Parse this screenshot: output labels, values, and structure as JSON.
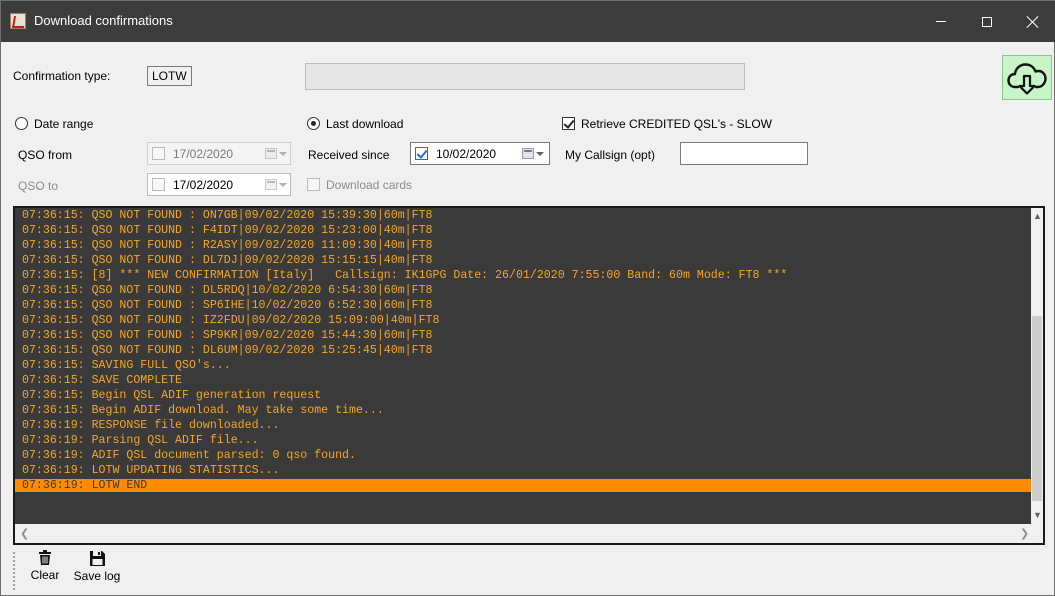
{
  "window": {
    "title": "Download confirmations",
    "title_bar_color": "#3c3c3c"
  },
  "form": {
    "confirmation_type_label": "Confirmation type:",
    "confirmation_type_value": "LOTW",
    "status_text": "",
    "date_range_label": "Date range",
    "date_range_selected": false,
    "last_download_label": "Last download",
    "last_download_selected": true,
    "retrieve_credited_label": "Retrieve CREDITED QSL's - SLOW",
    "retrieve_credited_checked": true,
    "qso_from_label": "QSO from",
    "qso_from_date": "17/02/2020",
    "qso_to_label": "QSO to",
    "qso_to_date": "17/02/2020",
    "received_since_label": "Received since",
    "received_since_date": "10/02/2020",
    "received_since_checked": true,
    "download_cards_label": "Download cards",
    "download_cards_checked": false,
    "my_callsign_label": "My Callsign (opt)",
    "my_callsign_value": ""
  },
  "download_button": {
    "icon": "cloud-download-icon",
    "background": "#c8f5c8"
  },
  "log": {
    "background": "#3a3a3a",
    "text_color": "#f5a623",
    "highlight_color": "#ff8c00",
    "lines": [
      "07:36:15: QSO NOT FOUND : ON7GB|09/02/2020 15:39:30|60m|FT8",
      "07:36:15: QSO NOT FOUND : F4IDT|09/02/2020 15:23:00|40m|FT8",
      "07:36:15: QSO NOT FOUND : R2ASY|09/02/2020 11:09:30|40m|FT8",
      "07:36:15: QSO NOT FOUND : DL7DJ|09/02/2020 15:15:15|40m|FT8",
      "07:36:15: [8] *** NEW CONFIRMATION [Italy]   Callsign: IK1GPG Date: 26/01/2020 7:55:00 Band: 60m Mode: FT8 ***",
      "07:36:15: QSO NOT FOUND : DL5RDQ|10/02/2020 6:54:30|60m|FT8",
      "07:36:15: QSO NOT FOUND : SP6IHE|10/02/2020 6:52:30|60m|FT8",
      "07:36:15: QSO NOT FOUND : IZ2FDU|09/02/2020 15:09:00|40m|FT8",
      "07:36:15: QSO NOT FOUND : SP9KR|09/02/2020 15:44:30|60m|FT8",
      "07:36:15: QSO NOT FOUND : DL6UM|09/02/2020 15:25:45|40m|FT8",
      "07:36:15: SAVING FULL QSO's...",
      "07:36:15: SAVE COMPLETE",
      "07:36:15: Begin QSL ADIF generation request",
      "07:36:15: Begin ADIF download. May take some time...",
      "07:36:19: RESPONSE file downloaded...",
      "07:36:19: Parsing QSL ADIF file...",
      "07:36:19: ADIF QSL document parsed: 0 qso found.",
      "07:36:19: LOTW UPDATING STATISTICS...",
      "07:36:19: LOTW END"
    ],
    "highlighted_line_index": 18
  },
  "toolbar": {
    "clear_label": "Clear",
    "save_log_label": "Save log"
  }
}
